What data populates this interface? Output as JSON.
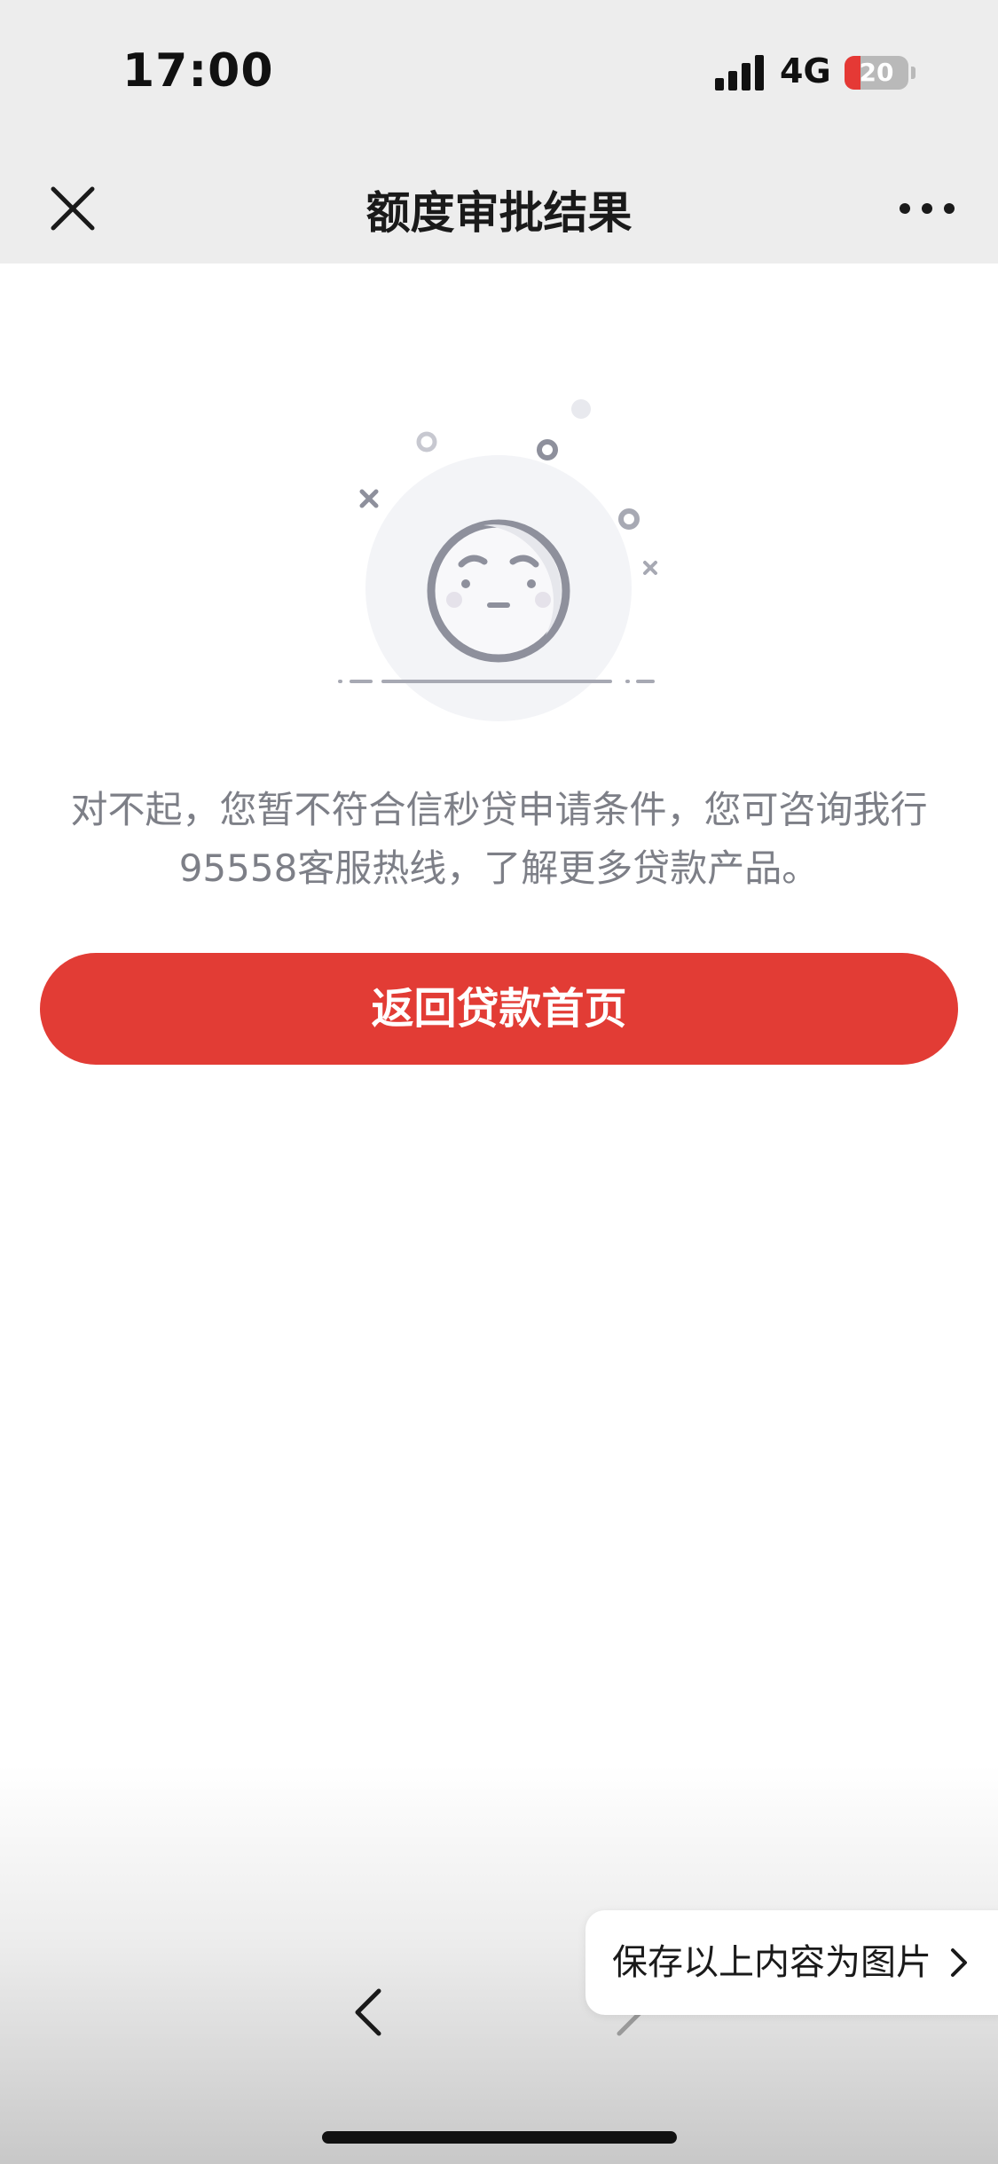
{
  "status_bar": {
    "time": "17:00",
    "network": "4G",
    "battery": "20"
  },
  "nav": {
    "title": "额度审批结果",
    "close_icon": "close-icon",
    "more_icon": "more-icon"
  },
  "result": {
    "icon": "sad-face-icon",
    "message": "对不起，您暂不符合信秒贷申请条件，您可咨询我行95558客服热线，了解更多贷款产品。"
  },
  "actions": {
    "primary_label": "返回贷款首页"
  },
  "browser_toolbar": {
    "back_icon": "chevron-left-icon",
    "forward_icon": "chevron-right-icon",
    "save_label": "保存以上内容为图片"
  },
  "colors": {
    "accent": "#e23c35",
    "header_bg": "#ededed",
    "message_text": "#7d7f87"
  }
}
